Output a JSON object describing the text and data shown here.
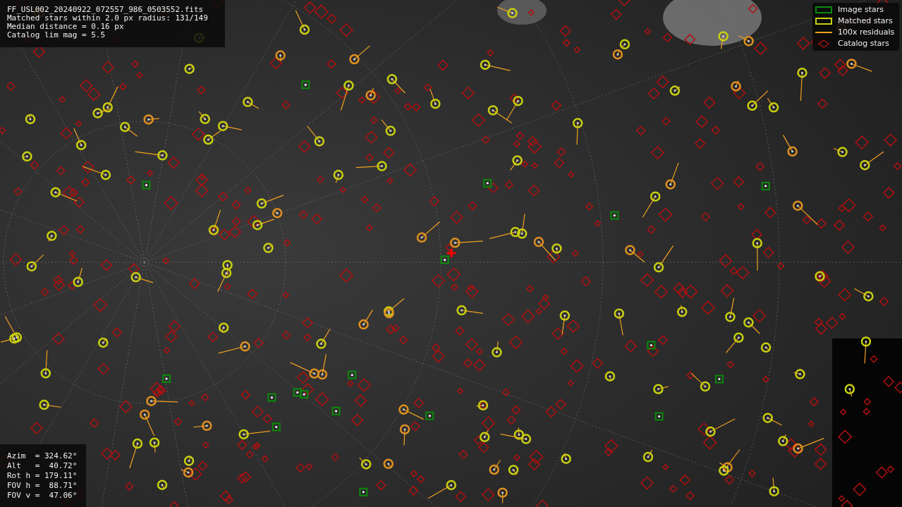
{
  "info_lines": [
    "FF_USL002_20240922_072557_986_0503552.fits",
    "Matched stars within 2.0 px radius: 131/149",
    "Median distance = 0.16 px",
    "Catalog lim mag = 5.5"
  ],
  "legend": [
    {
      "kind": "image",
      "label": "Image stars"
    },
    {
      "kind": "matched",
      "label": "Matched stars"
    },
    {
      "kind": "residual",
      "label": "100x residuals"
    },
    {
      "kind": "catalog",
      "label": "Catalog stars"
    }
  ],
  "pointing": [
    {
      "label": "Azim  =",
      "value": "324.62°"
    },
    {
      "label": "Alt   =",
      "value": " 40.72°"
    },
    {
      "label": "Rot h =",
      "value": "179.11°"
    },
    {
      "label": "FOV h =",
      "value": " 88.71°"
    },
    {
      "label": "FOV v =",
      "value": " 47.06°"
    }
  ]
}
